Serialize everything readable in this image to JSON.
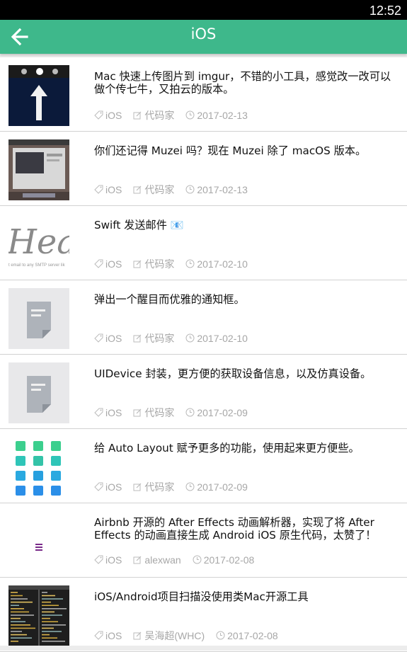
{
  "status_bar": {
    "time": "12:52"
  },
  "app_bar": {
    "title": "iOS",
    "back_icon": "arrow-left-icon",
    "background": "#3eb88b"
  },
  "meta_icons": {
    "tag": "tag-icon",
    "author": "edit-icon",
    "date": "clock-icon"
  },
  "items": [
    {
      "title": "Mac 快速上传图片到 imgur，不错的小工具，感觉改一改可以做个传七牛，又拍云的版本。",
      "tag": "iOS",
      "author": "代码家",
      "date": "2017-02-13",
      "thumb": "upload-arrow"
    },
    {
      "title": "你们还记得 Muzei 吗？现在 Muzei 除了 macOS 版本。",
      "tag": "iOS",
      "author": "代码家",
      "date": "2017-02-13",
      "thumb": "screenshot"
    },
    {
      "title": "Swift 发送邮件 📧",
      "tag": "iOS",
      "author": "代码家",
      "date": "2017-02-10",
      "thumb": "hea",
      "thumb_text": "Hea",
      "thumb_caption": "t email to any SMTP server lik"
    },
    {
      "title": "弹出一个醒目而优雅的通知框。",
      "tag": "iOS",
      "author": "代码家",
      "date": "2017-02-10",
      "thumb": "doc"
    },
    {
      "title": "UIDevice 封装，更方便的获取设备信息，以及仿真设备。",
      "tag": "iOS",
      "author": "代码家",
      "date": "2017-02-09",
      "thumb": "doc"
    },
    {
      "title": "给 Auto Layout 赋予更多的功能，使用起来更方便些。",
      "tag": "iOS",
      "author": "代码家",
      "date": "2017-02-09",
      "thumb": "grid"
    },
    {
      "title": "Airbnb 开源的 After Effects 动画解析器，实现了将 After Effects 的动画直接生成 Android iOS 原生代码，太赞了！",
      "tag": "iOS",
      "author": "alexwan",
      "date": "2017-02-08",
      "thumb": "menu"
    },
    {
      "title": "iOS/Android项目扫描没使用类Mac开源工具",
      "tag": "iOS",
      "author": "吴海超(WHC)",
      "date": "2017-02-08",
      "thumb": "code"
    }
  ]
}
